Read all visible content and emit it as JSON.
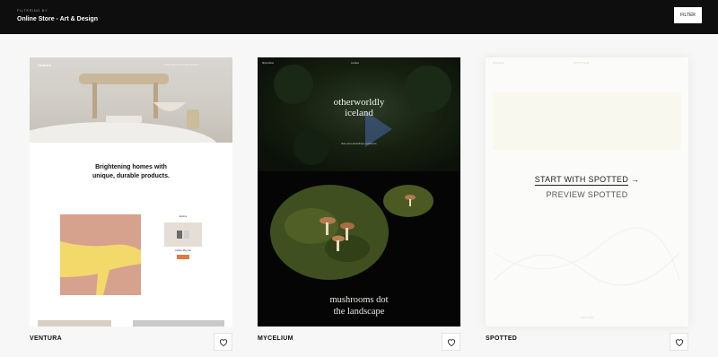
{
  "header": {
    "filter_caption": "FILTERING BY",
    "filter_value": "Online Store - Art & Design",
    "filter_button": "FILTER"
  },
  "templates": [
    {
      "name": "VENTURA",
      "preview": {
        "logo": "Ventura",
        "nav": "Shop   About   Journal   Contact",
        "headline": "Brightening homes with unique, durable products.",
        "shop_label": "Explore",
        "product_name": "Golden Mug Set"
      }
    },
    {
      "name": "MYCELIUM",
      "preview": {
        "nav_left": "Shop   About",
        "nav_center": "Lumière",
        "title_line1": "otherworldly",
        "title_line2": "iceland",
        "subtitle": "Rare and extraordinary mushrooms",
        "caption_line1": "mushrooms dot",
        "caption_line2": "the landscape"
      }
    },
    {
      "name": "SPOTTED",
      "preview": {
        "nav": "Shop   About",
        "logo": "SPOTTED",
        "start_label": "START WITH SPOTTED",
        "start_arrow": "→",
        "preview_label": "PREVIEW SPOTTED",
        "footer": "SPOTTED"
      }
    }
  ],
  "colors": {
    "header_bg": "#0e0e0e",
    "page_bg": "#f7f7f7",
    "accent_orange": "#e0793d"
  }
}
